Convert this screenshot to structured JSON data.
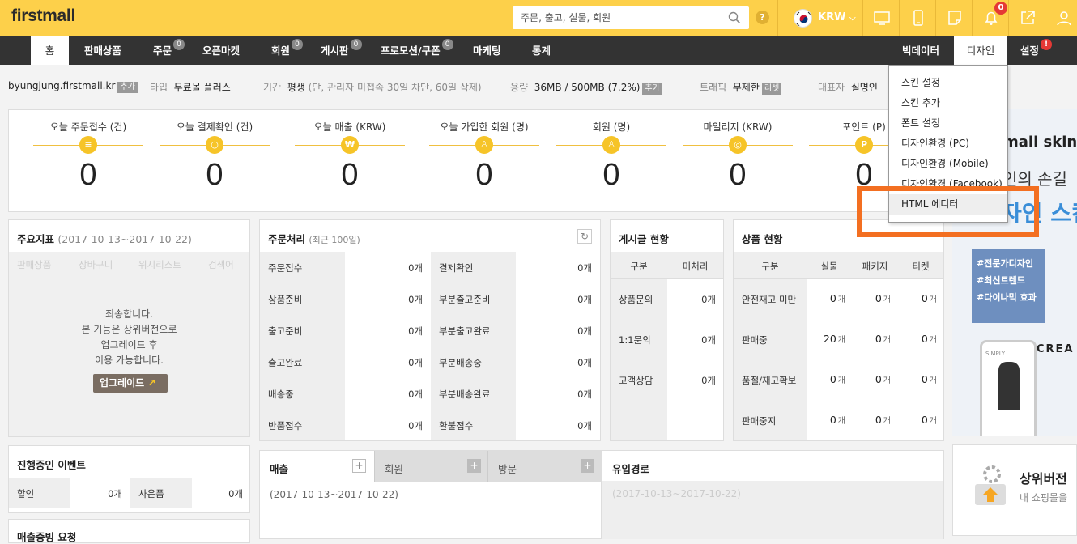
{
  "topbar": {
    "logo": "firstmall",
    "search_placeholder": "주문, 출고, 실물, 회원",
    "help_label": "?",
    "currency": "KRW",
    "notification_count": "0",
    "colors": {
      "topbar": "#fdd04a",
      "nav": "#333333",
      "highlight": "#f36f21",
      "badge_red": "#e53935"
    }
  },
  "nav": {
    "items": [
      {
        "label": "홈",
        "badge": ""
      },
      {
        "label": "판매상품",
        "badge": ""
      },
      {
        "label": "주문",
        "badge": "0"
      },
      {
        "label": "오픈마켓",
        "badge": ""
      },
      {
        "label": "회원",
        "badge": "0"
      },
      {
        "label": "게시판",
        "badge": "0"
      },
      {
        "label": "프로모션/쿠폰",
        "badge": "0"
      },
      {
        "label": "마케팅",
        "badge": ""
      },
      {
        "label": "통계",
        "badge": ""
      }
    ],
    "right_items": [
      {
        "label": "빅데이터"
      },
      {
        "label": "디자인"
      },
      {
        "label": "설정",
        "badge": "!"
      }
    ]
  },
  "info": {
    "domain": "byungjung.firstmall.kr",
    "domain_tag": "추가",
    "type_label": "타입",
    "type_value": "무료몰 플러스",
    "period_label": "기간",
    "period_value": "평생",
    "period_note": "(단, 관리자 미접속 30일 차단, 60일 삭제)",
    "capacity_label": "용량",
    "capacity_value": "36MB / 500MB (7.2%)",
    "capacity_tag": "추가",
    "traffic_label": "트래픽",
    "traffic_value": "무제한",
    "traffic_tag": "리셋",
    "owner_label": "대표자",
    "owner_value": "실명인"
  },
  "stats": [
    {
      "label": "오늘 주문접수 (건)",
      "icon": "receipt-icon",
      "glyph": "≡",
      "value": "0"
    },
    {
      "label": "오늘 결제확인 (건)",
      "icon": "search-icon",
      "glyph": "○",
      "value": "0"
    },
    {
      "label": "오늘 매출 (KRW)",
      "icon": "won-icon",
      "glyph": "₩",
      "value": "0"
    },
    {
      "label": "오늘 가입한 회원 (명)",
      "icon": "user-icon",
      "glyph": "♙",
      "value": "0"
    },
    {
      "label": "회원 (명)",
      "icon": "users-icon",
      "glyph": "♙",
      "value": "0"
    },
    {
      "label": "마일리지 (KRW)",
      "icon": "coin-icon",
      "glyph": "◎",
      "value": "0"
    },
    {
      "label": "포인트 (P)",
      "icon": "point-icon",
      "glyph": "P",
      "value": "0"
    }
  ],
  "key_metrics": {
    "title": "주요지표",
    "range": "(2017-10-13~2017-10-22)",
    "tabs": [
      "판매상품",
      "장바구니",
      "위시리스트",
      "검색어"
    ],
    "notice_lines": [
      "죄송합니다.",
      "본 기능은 상위버전으로",
      "업그레이드 후",
      "이용 가능합니다."
    ],
    "upgrade_button": "업그레이드"
  },
  "orders": {
    "title": "주문처리",
    "sub": "(최근 100일)",
    "left": [
      {
        "label": "주문접수",
        "value": "0개"
      },
      {
        "label": "상품준비",
        "value": "0개"
      },
      {
        "label": "출고준비",
        "value": "0개"
      },
      {
        "label": "출고완료",
        "value": "0개"
      },
      {
        "label": "배송중",
        "value": "0개"
      },
      {
        "label": "반품접수",
        "value": "0개"
      }
    ],
    "right": [
      {
        "label": "결제확인",
        "value": "0개"
      },
      {
        "label": "부분출고준비",
        "value": "0개"
      },
      {
        "label": "부분출고완료",
        "value": "0개"
      },
      {
        "label": "부분배송중",
        "value": "0개"
      },
      {
        "label": "부분배송완료",
        "value": "0개"
      },
      {
        "label": "환불접수",
        "value": "0개"
      }
    ]
  },
  "board": {
    "title": "게시글 현황",
    "headers": [
      "구분",
      "미처리"
    ],
    "rows": [
      {
        "label": "상품문의",
        "value": "0개"
      },
      {
        "label": "1:1문의",
        "value": "0개"
      },
      {
        "label": "고객상담",
        "value": "0개"
      }
    ]
  },
  "products": {
    "title": "상품 현황",
    "headers": [
      "구분",
      "실물",
      "패키지",
      "티켓"
    ],
    "rows": [
      {
        "label": "안전재고 미만",
        "a": "0",
        "b": "0",
        "c": "0"
      },
      {
        "label": "판매중",
        "a": "20",
        "b": "0",
        "c": "0"
      },
      {
        "label": "품절/재고확보",
        "a": "0",
        "b": "0",
        "c": "0"
      },
      {
        "label": "판매중지",
        "a": "0",
        "b": "0",
        "c": "0"
      }
    ],
    "unit": "개"
  },
  "events": {
    "title": "진행중인 이벤트",
    "items": [
      {
        "label": "할인",
        "value": "0개"
      },
      {
        "label": "사은품",
        "value": "0개"
      }
    ]
  },
  "shipping_request": {
    "title": "매출증빙 요청"
  },
  "sales": {
    "tabs": [
      "매출",
      "회원",
      "방문"
    ],
    "range": "(2017-10-13~2017-10-22)"
  },
  "inflow": {
    "title": "유입경로",
    "range": "(2017-10-13~2017-10-22)"
  },
  "design_menu": {
    "items": [
      {
        "label": "스킨 설정"
      },
      {
        "label": "스킨 추가"
      },
      {
        "label": "폰트 설정"
      },
      {
        "label": "디자인환경 (PC)"
      },
      {
        "label": "디자인환경 (Mobile)"
      },
      {
        "label": "디자인환경 (Facebook)"
      },
      {
        "label": "HTML 에디터"
      }
    ]
  },
  "promo": {
    "skin_title": "mall skin",
    "line2": "인의 손길",
    "line3": "자인 스킨",
    "tags": [
      "#전문가디자인",
      "#최신트렌드",
      "#다이나믹 효과"
    ],
    "phone_brand": "SIMPLY",
    "crea": "CREA",
    "upgrade_title": "상위버전",
    "upgrade_sub": "내 쇼핑몰을"
  }
}
